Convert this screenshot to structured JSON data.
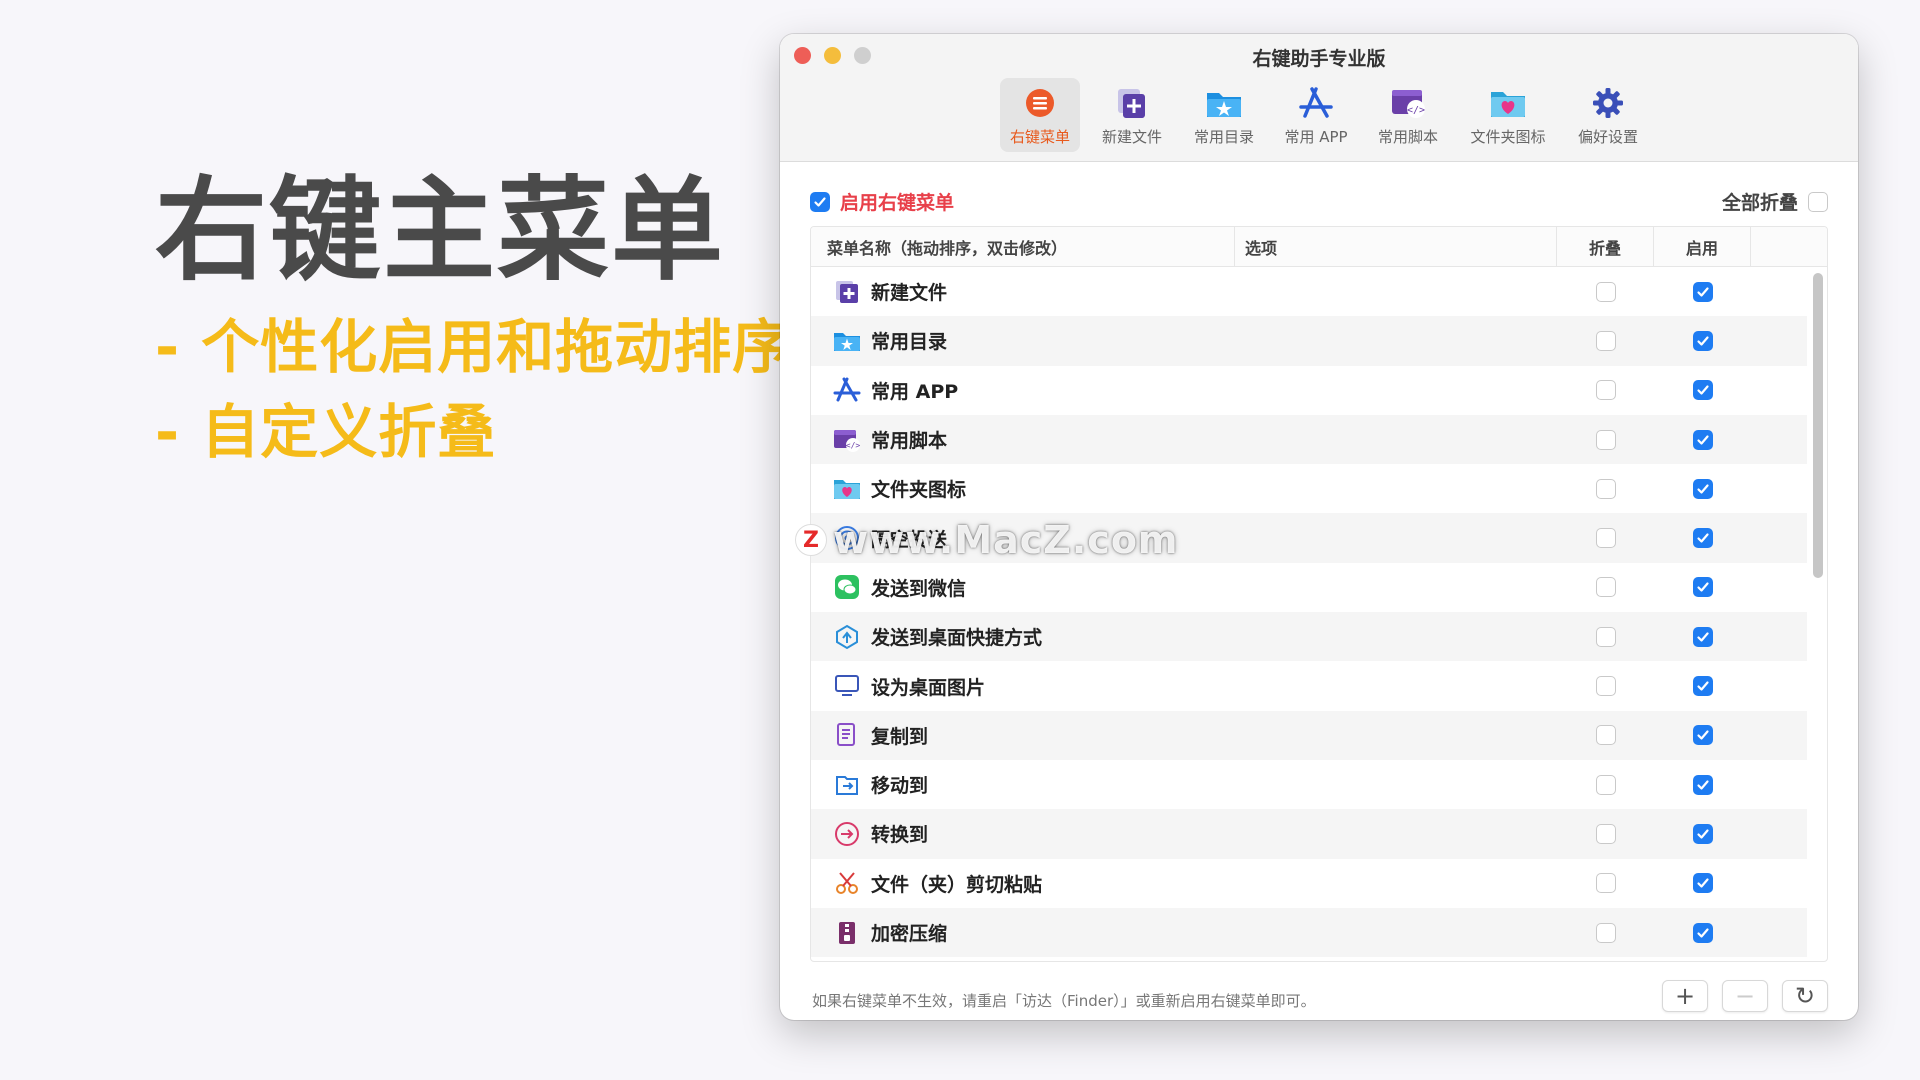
{
  "slide": {
    "headline": "右键主菜单",
    "bullets": [
      "- 个性化启用和拖动排序",
      "- 自定义折叠"
    ]
  },
  "window": {
    "title": "右键助手专业版",
    "toolbar": [
      {
        "label": "右键菜单",
        "icon": "context-menu-icon",
        "active": true
      },
      {
        "label": "新建文件",
        "icon": "new-file-icon"
      },
      {
        "label": "常用目录",
        "icon": "folder-star-icon"
      },
      {
        "label": "常用 APP",
        "icon": "app-store-icon"
      },
      {
        "label": "常用脚本",
        "icon": "script-icon"
      },
      {
        "label": "文件夹图标",
        "icon": "folder-heart-icon"
      },
      {
        "label": "偏好设置",
        "icon": "gear-icon"
      }
    ],
    "enable_label": "启用右键菜单",
    "enable_checked": true,
    "collapse_all_label": "全部折叠",
    "collapse_all_checked": false
  },
  "table": {
    "headers": {
      "name": "菜单名称（拖动排序，双击修改）",
      "options": "选项",
      "fold": "折叠",
      "enable": "启用"
    },
    "rows": [
      {
        "name": "新建文件",
        "icon": "new-file-icon",
        "fold": false,
        "enabled": true
      },
      {
        "name": "常用目录",
        "icon": "folder-star-icon",
        "fold": false,
        "enabled": true
      },
      {
        "name": "常用 APP",
        "icon": "app-store-icon",
        "fold": false,
        "enabled": true
      },
      {
        "name": "常用脚本",
        "icon": "script-icon",
        "fold": false,
        "enabled": true
      },
      {
        "name": "文件夹图标",
        "icon": "folder-heart-icon",
        "fold": false,
        "enabled": true
      },
      {
        "name": "隔空投送",
        "icon": "airdrop-icon",
        "fold": false,
        "enabled": true
      },
      {
        "name": "发送到微信",
        "icon": "wechat-icon",
        "fold": false,
        "enabled": true
      },
      {
        "name": "发送到桌面快捷方式",
        "icon": "shortcut-icon",
        "fold": false,
        "enabled": true
      },
      {
        "name": "设为桌面图片",
        "icon": "monitor-icon",
        "fold": false,
        "enabled": true
      },
      {
        "name": "复制到",
        "icon": "copy-icon",
        "fold": false,
        "enabled": true
      },
      {
        "name": "移动到",
        "icon": "move-icon",
        "fold": false,
        "enabled": true
      },
      {
        "name": "转换到",
        "icon": "convert-icon",
        "fold": false,
        "enabled": true
      },
      {
        "name": "文件（夹）剪切粘贴",
        "icon": "scissors-icon",
        "fold": false,
        "enabled": true
      },
      {
        "name": "加密压缩",
        "icon": "archive-icon",
        "fold": false,
        "enabled": true
      }
    ]
  },
  "footer": {
    "hint": "如果右键菜单不生效，请重启「访达（Finder）」或重新启用右键菜单即可。",
    "add_label": "+",
    "remove_label": "−",
    "refresh_label": "↻"
  },
  "watermark": {
    "logo": "Z",
    "text": "www.MacZ.com"
  },
  "colors": {
    "accent": "#1e7cf2",
    "slide_bullet": "#f5bb19",
    "enable_label": "#e8404a"
  }
}
